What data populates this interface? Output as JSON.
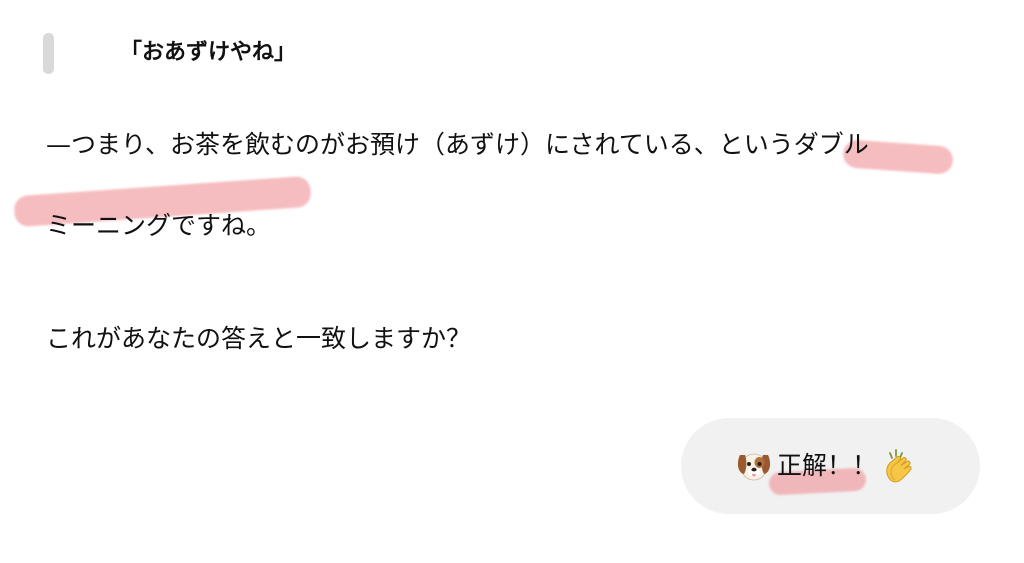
{
  "quote": {
    "text": "「おあずけやね」"
  },
  "body": {
    "line1": "—つまり、お茶を飲むのがお預け（あずけ）にされている、というダブル",
    "line2": "ミーニングですね。",
    "line3": "これがあなたの答えと一致しますか？"
  },
  "reply": {
    "text": "正解！！",
    "leading_icon": "dog-face-icon",
    "trailing_icon": "clapping-hands-icon"
  },
  "colors": {
    "highlight": "#ef878c",
    "bubble_background": "#f1f1f1",
    "quote_bar": "#d9d9d9"
  }
}
